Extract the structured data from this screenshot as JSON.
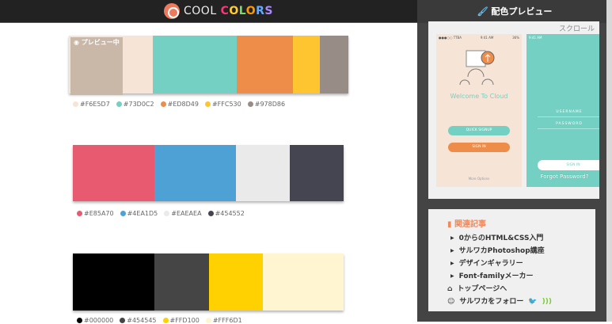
{
  "header": {
    "logo_a": "COOL ",
    "logo_b": "COLORS"
  },
  "sidebar": {
    "title": "配色プレビュー",
    "scroll_label": "スクロール",
    "preview": {
      "status_left": "●●●○○ TTBA",
      "status_mid": "9:41 AM",
      "status_right": "36%",
      "welcome": "Welcome To Cloud",
      "quick_signup": "QUICK SIGNUP",
      "sign_in": "SIGN IN",
      "more": "More Options",
      "username": "USERNAME",
      "password": "PASSWORD",
      "sign_in2": "SIGN IN",
      "forgot": "Forgot Password?"
    },
    "related": {
      "title": "関連記事",
      "items": [
        "0からのHTML&CSS入門",
        "サルワカPhotoshop講座",
        "デザインギャラリー",
        "Font-familyメーカー"
      ],
      "home": "トップページへ",
      "follow": "サルワカをフォロー"
    }
  },
  "palettes": [
    {
      "badge": "プレビュー中",
      "colors": [
        "#F6E5D7",
        "#73D0C2",
        "#ED8D49",
        "#FFC530",
        "#978D86"
      ]
    },
    {
      "colors": [
        "#E85A70",
        "#4EA1D5",
        "#EAEAEA",
        "#454552"
      ]
    },
    {
      "colors": [
        "#000000",
        "#454545",
        "#FFD100",
        "#FFF6D1"
      ]
    }
  ]
}
